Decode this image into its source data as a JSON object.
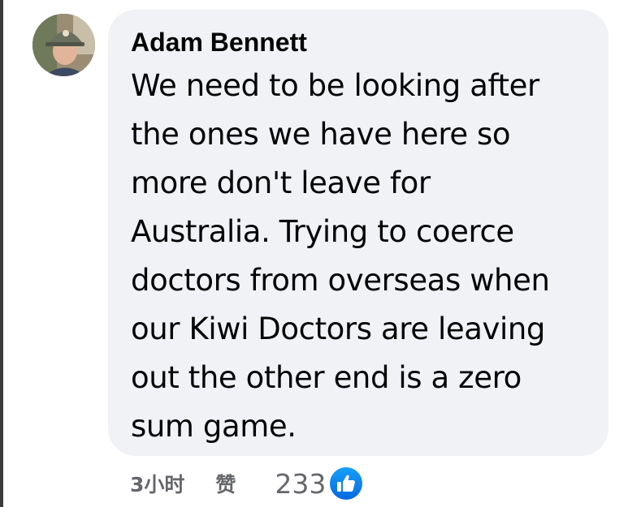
{
  "comment": {
    "author": "Adam Bennett",
    "lines": [
      "We need to be looking after",
      "the ones we have here so",
      "more don't leave for",
      "Australia. Trying to coerce",
      "doctors from overseas when",
      "our Kiwi Doctors are leaving",
      "out the other end is a zero",
      "sum game."
    ],
    "time": "3小时",
    "like_label": "赞",
    "reaction_count": "233",
    "reaction_icon": "thumbs-up-icon"
  },
  "colors": {
    "bubble": "#f0f2f5",
    "text": "#050505",
    "secondary": "#65676b",
    "like_blue": "#1877f2"
  }
}
